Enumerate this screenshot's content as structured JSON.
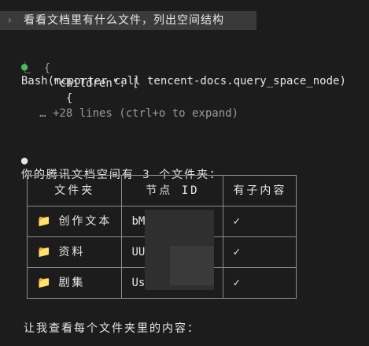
{
  "prompt": {
    "chevron": "›",
    "text": "看看文档里有什么文件，列出空间结构"
  },
  "tool_call": {
    "bullet": "●",
    "command": "Bash(mcporter call tencent-docs.query_space_node)",
    "output_lines": [
      "  ⎿  {",
      "       \"children\": [",
      "         {",
      "     … +28 lines (ctrl+o to expand)"
    ]
  },
  "response": {
    "bullet": "●",
    "text": "你的腾讯文档空间有 3 个文件夹："
  },
  "table": {
    "headers": [
      "文件夹",
      "节点 ID",
      "有子内容"
    ],
    "rows": [
      {
        "icon": "📁",
        "name": "创作文本",
        "id": "bM",
        "has_children": "✓"
      },
      {
        "icon": "📁",
        "name": "资料",
        "id": "UU",
        "has_children": "✓"
      },
      {
        "icon": "📁",
        "name": "剧集",
        "id": "Us",
        "has_children": "✓"
      }
    ]
  },
  "followup": {
    "text": "让我查看每个文件夹里的内容："
  },
  "colors": {
    "background": "#1c1c1c",
    "prompt_bg": "#3a3a3a",
    "success_dot": "#3fbf55",
    "folder": "#e2b244"
  }
}
